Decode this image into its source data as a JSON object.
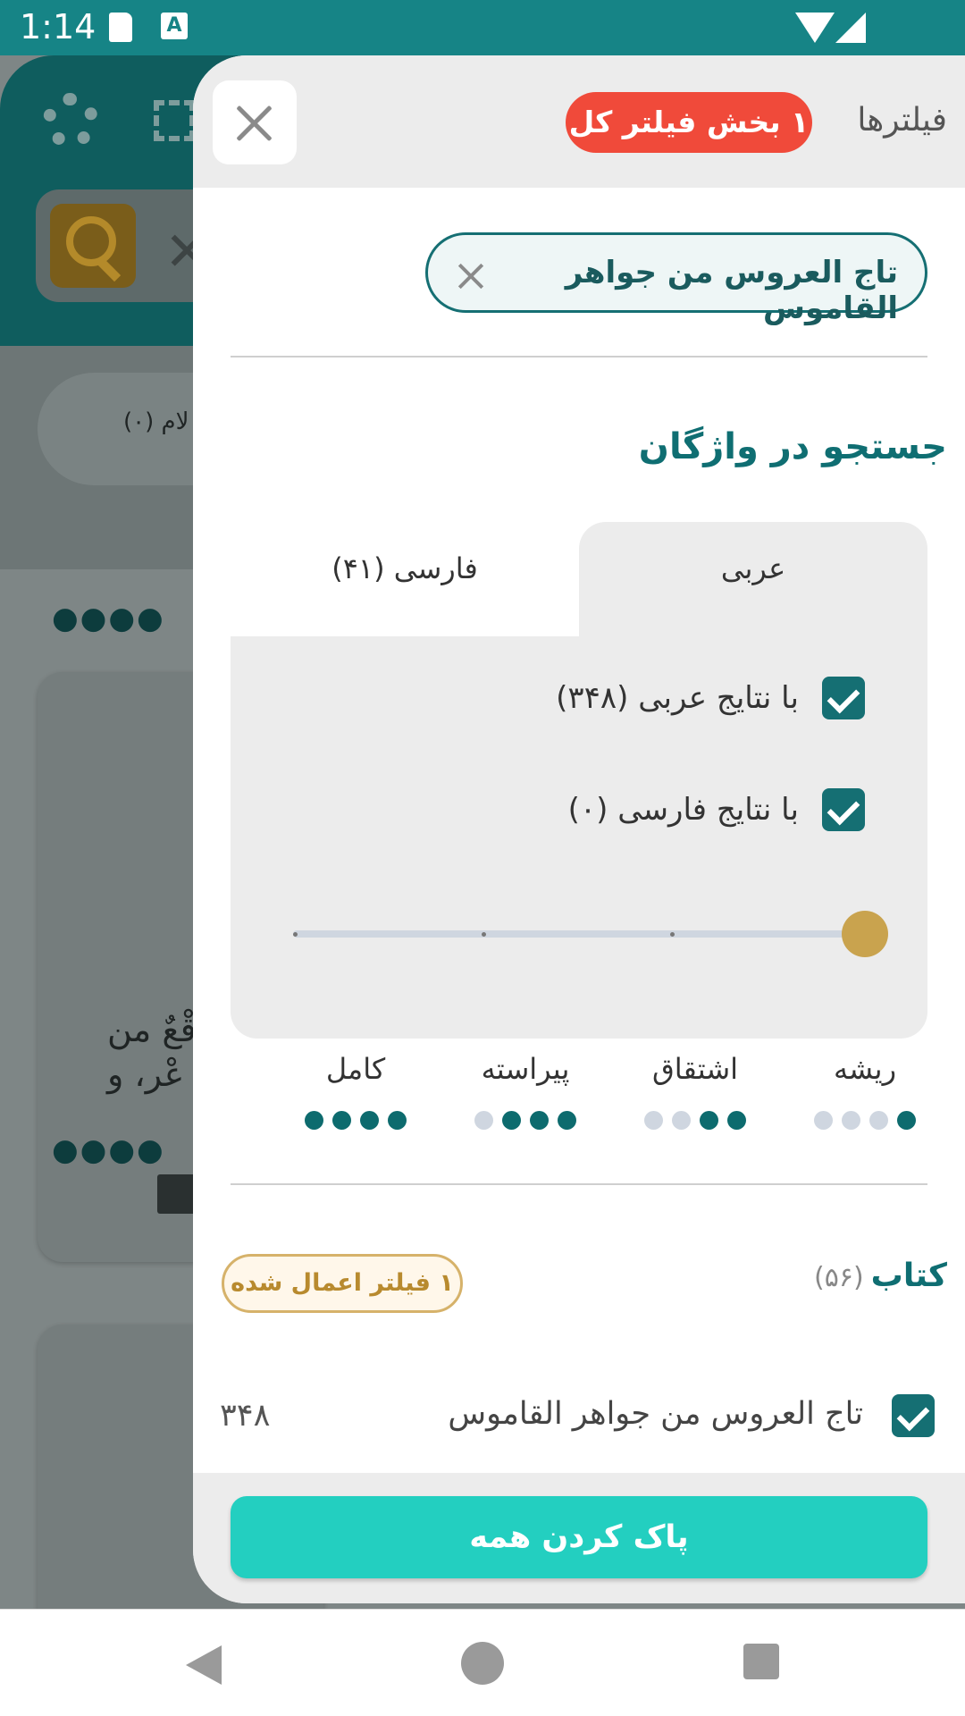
{
  "status_bar": {
    "time": "1:14"
  },
  "background": {
    "chip_text": "لام (۰)",
    "card_text_line1": "قْعٌ من",
    "card_text_line2": "عْر، و",
    "dots": "●●●●"
  },
  "drawer": {
    "title": "فیلترها",
    "filter_badge": "۱ بخش فیلتر کل",
    "active_chip": "تاج العروس من جواهر القاموس",
    "section_title": "جستجو در واژگان",
    "tabs": [
      {
        "label": "عربی",
        "selected": true
      },
      {
        "label": "فارسی (۴۱)",
        "selected": false
      }
    ],
    "checkboxes": [
      {
        "label": "با نتایج عربی (۳۴۸)",
        "checked": true
      },
      {
        "label": "با نتایج فارسی (۰)",
        "checked": false
      }
    ],
    "slider": {
      "value_index": 0,
      "count": 4
    },
    "levels": [
      {
        "label": "ریشه",
        "filled": 1
      },
      {
        "label": "اشتقاق",
        "filled": 2
      },
      {
        "label": "پیراسته",
        "filled": 3
      },
      {
        "label": "کامل",
        "filled": 4
      }
    ],
    "book_section": {
      "label": "کتاب",
      "count": "(۵۶)",
      "applied_badge": "۱ فیلتر اعمال شده",
      "items": [
        {
          "name": "تاج العروس من جواهر القاموس",
          "count": "۳۴۸",
          "checked": true
        }
      ]
    },
    "clear_all": "پاک کردن همه"
  },
  "colors": {
    "primary_teal": "#156f73",
    "accent_gold": "#c9a34e",
    "badge_red": "#f04a3a",
    "clear_button": "#23cfc0"
  }
}
